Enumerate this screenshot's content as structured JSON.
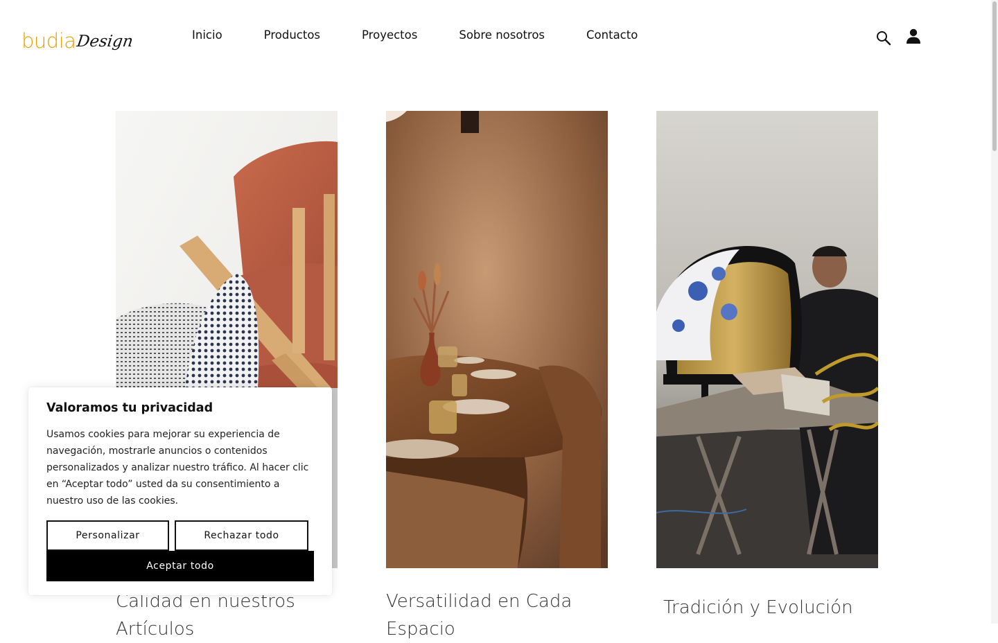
{
  "brand": {
    "logo_part1": "budia",
    "logo_part2": "Design",
    "accent_color": "#e8a100"
  },
  "nav": {
    "items": [
      {
        "label": "Inicio"
      },
      {
        "label": "Productos"
      },
      {
        "label": "Proyectos"
      },
      {
        "label": "Sobre nosotros"
      },
      {
        "label": "Contacto"
      }
    ]
  },
  "header_icons": {
    "search": "search-icon",
    "account": "user-icon"
  },
  "cards": [
    {
      "title": "Calidad en nuestros Artículos",
      "image": "orange-upholstered-chair-with-patterned-cushion"
    },
    {
      "title": "Versatilidad en Cada Espacio",
      "image": "restaurant-wooden-table-setting"
    },
    {
      "title": "Tradición y Evolución",
      "image": "craftsman-upholstering-armchair"
    }
  ],
  "cookie_banner": {
    "title": "Valoramos tu privacidad",
    "text": "Usamos cookies para mejorar su experiencia de navegación, mostrarle anuncios o contenidos personalizados y analizar nuestro tráfico. Al hacer clic en “Aceptar todo” usted da su consentimiento a nuestro uso de las cookies.",
    "customize_label": "Personalizar",
    "reject_label": "Rechazar todo",
    "accept_label": "Aceptar todo"
  }
}
